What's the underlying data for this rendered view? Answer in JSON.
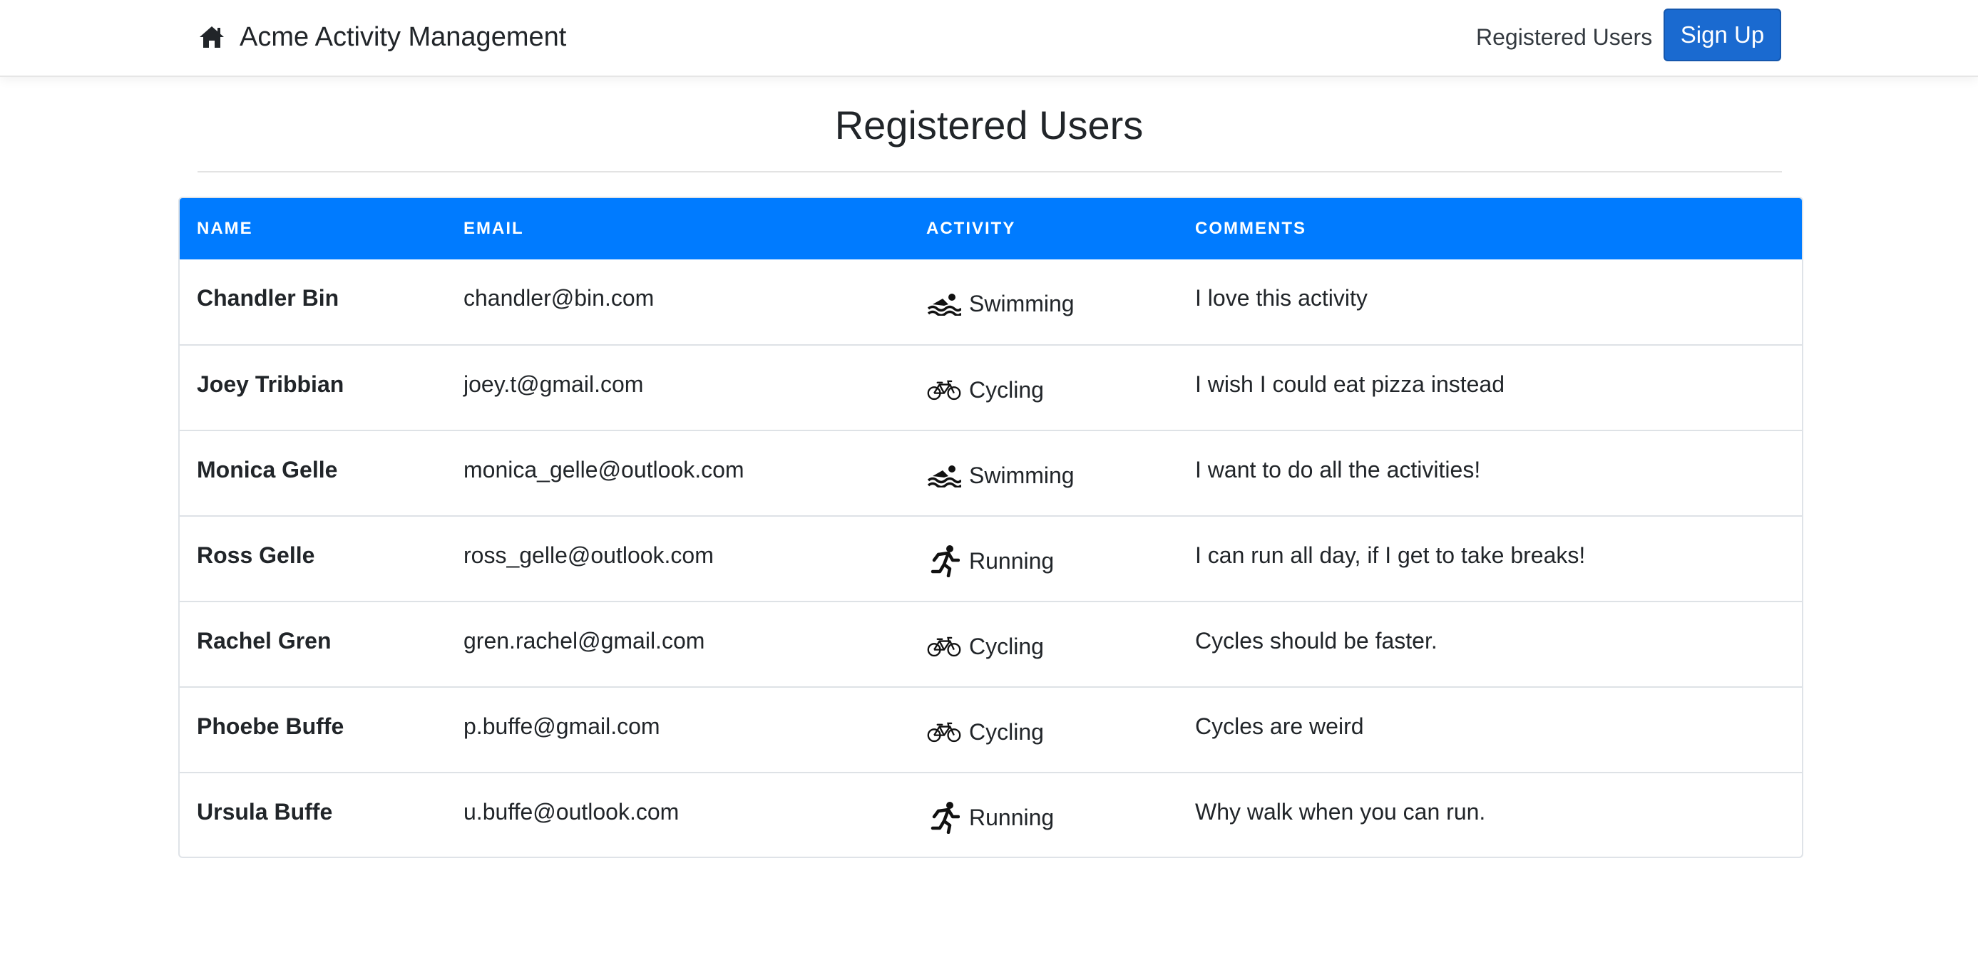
{
  "navbar": {
    "brand_icon": "home-icon",
    "brand_text": "Acme Activity Management",
    "nav_link": "Registered Users",
    "signup_label": "Sign Up",
    "signup_color": "#1a6ad0"
  },
  "page": {
    "title": "Registered Users"
  },
  "table": {
    "header_color": "#007bff",
    "columns": [
      "NAME",
      "EMAIL",
      "ACTIVITY",
      "COMMENTS"
    ],
    "rows": [
      {
        "name": "Chandler Bin",
        "email": "chandler@bin.com",
        "activity": "Swimming",
        "icon": "swimming-icon",
        "comment": "I love this activity"
      },
      {
        "name": "Joey Tribbian",
        "email": "joey.t@gmail.com",
        "activity": "Cycling",
        "icon": "cycling-icon",
        "comment": "I wish I could eat pizza instead"
      },
      {
        "name": "Monica Gelle",
        "email": "monica_gelle@outlook.com",
        "activity": "Swimming",
        "icon": "swimming-icon",
        "comment": "I want to do all the activities!"
      },
      {
        "name": "Ross Gelle",
        "email": "ross_gelle@outlook.com",
        "activity": "Running",
        "icon": "running-icon",
        "comment": "I can run all day, if I get to take breaks!"
      },
      {
        "name": "Rachel Gren",
        "email": "gren.rachel@gmail.com",
        "activity": "Cycling",
        "icon": "cycling-icon",
        "comment": "Cycles should be faster."
      },
      {
        "name": "Phoebe Buffe",
        "email": "p.buffe@gmail.com",
        "activity": "Cycling",
        "icon": "cycling-icon",
        "comment": "Cycles are weird"
      },
      {
        "name": "Ursula Buffe",
        "email": "u.buffe@outlook.com",
        "activity": "Running",
        "icon": "running-icon",
        "comment": "Why walk when you can run."
      }
    ]
  }
}
